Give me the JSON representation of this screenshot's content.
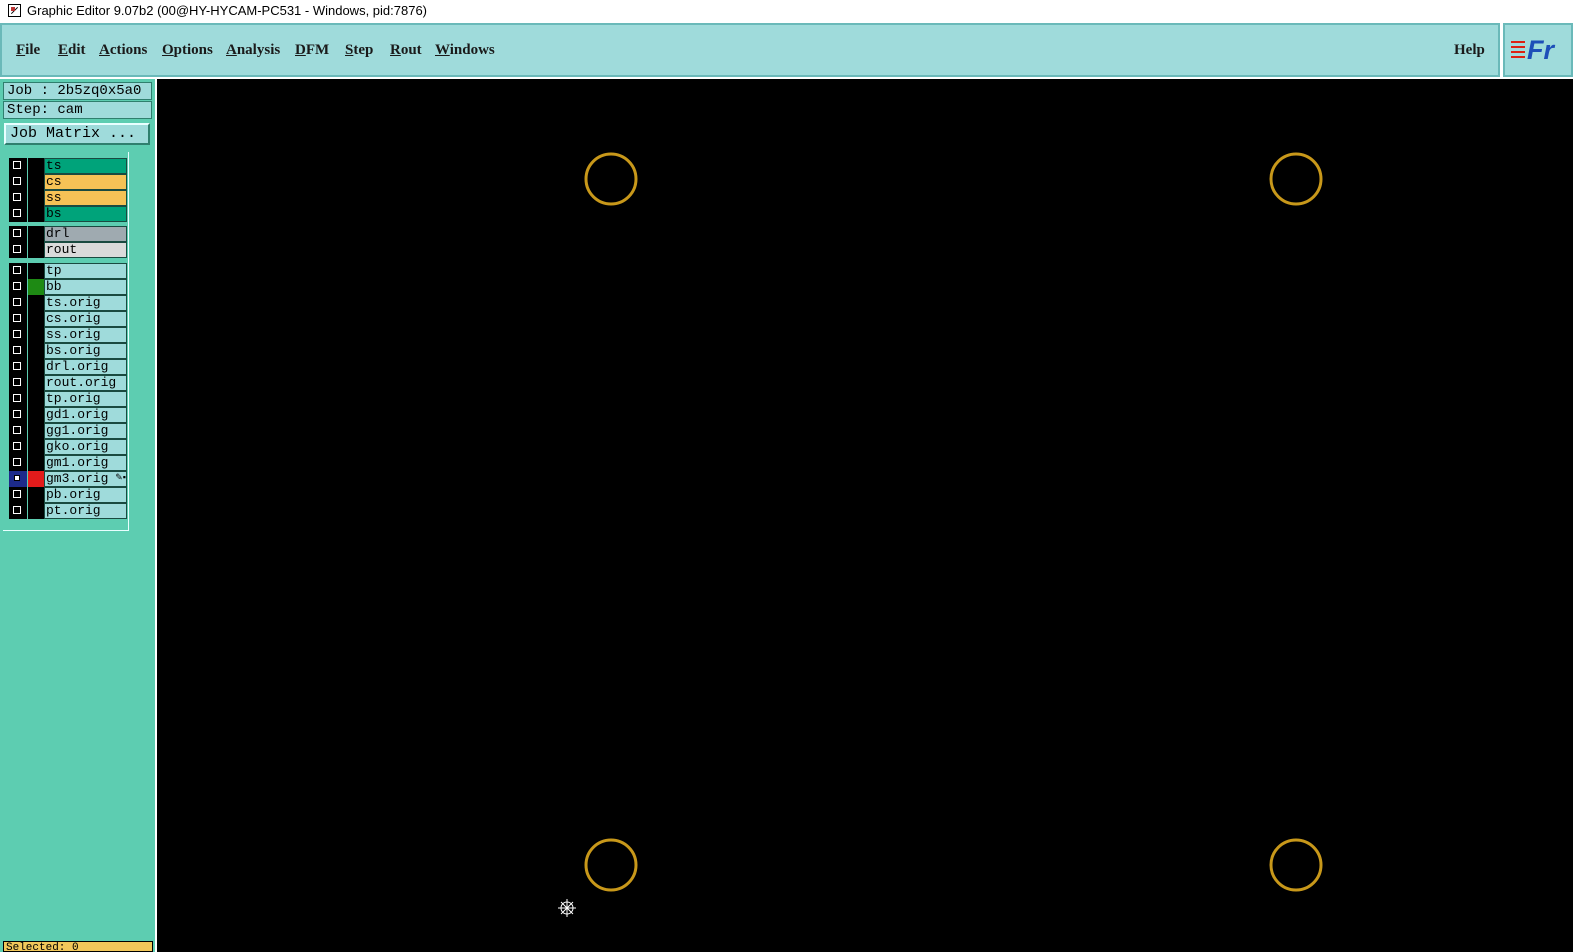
{
  "window": {
    "title": "Graphic Editor 9.07b2 (00@HY-HYCAM-PC531 - Windows, pid:7876)"
  },
  "menu": {
    "items": [
      {
        "label": "File",
        "name": "file"
      },
      {
        "label": "Edit",
        "name": "edit"
      },
      {
        "label": "Actions",
        "name": "actions"
      },
      {
        "label": "Options",
        "name": "options"
      },
      {
        "label": "Analysis",
        "name": "analysis"
      },
      {
        "label": "DFM",
        "name": "dfm"
      },
      {
        "label": "Step",
        "name": "step"
      },
      {
        "label": "Rout",
        "name": "rout"
      },
      {
        "label": "Windows",
        "name": "windows"
      }
    ],
    "help": "Help",
    "logo_text": "Fr"
  },
  "panel": {
    "job": "Job : 2b5zq0x5a0",
    "step": "Step: cam",
    "job_matrix": "Job Matrix ...",
    "bottom_text": "Selected: 0"
  },
  "layers": [
    {
      "name": "ts",
      "bg": "#00a37a",
      "swatch": "#000000"
    },
    {
      "name": "cs",
      "bg": "#f6c256",
      "swatch": "#000000"
    },
    {
      "name": "ss",
      "bg": "#f6c256",
      "swatch": "#000000"
    },
    {
      "name": "bs",
      "bg": "#00a37a",
      "swatch": "#000000"
    },
    {
      "name": "drl",
      "bg": "#9faab0",
      "swatch": "#000000"
    },
    {
      "name": "rout",
      "bg": "#dadada",
      "swatch": "#000000"
    },
    {
      "name": "tp",
      "bg": "#9fdbdb",
      "swatch": "#000000"
    },
    {
      "name": "bb",
      "bg": "#9fdbdb",
      "swatch": "#1e8a14"
    },
    {
      "name": "ts.orig",
      "bg": "#9fdbdb",
      "swatch": "#000000"
    },
    {
      "name": "cs.orig",
      "bg": "#9fdbdb",
      "swatch": "#000000"
    },
    {
      "name": "ss.orig",
      "bg": "#9fdbdb",
      "swatch": "#000000"
    },
    {
      "name": "bs.orig",
      "bg": "#9fdbdb",
      "swatch": "#000000"
    },
    {
      "name": "drl.orig",
      "bg": "#9fdbdb",
      "swatch": "#000000"
    },
    {
      "name": "rout.orig",
      "bg": "#9fdbdb",
      "swatch": "#000000"
    },
    {
      "name": "tp.orig",
      "bg": "#9fdbdb",
      "swatch": "#000000"
    },
    {
      "name": "gd1.orig",
      "bg": "#9fdbdb",
      "swatch": "#000000"
    },
    {
      "name": "gg1.orig",
      "bg": "#9fdbdb",
      "swatch": "#000000"
    },
    {
      "name": "gko.orig",
      "bg": "#9fdbdb",
      "swatch": "#000000"
    },
    {
      "name": "gm1.orig",
      "bg": "#9fdbdb",
      "swatch": "#000000"
    },
    {
      "name": "gm3.orig",
      "bg": "#9fdbdb",
      "swatch": "#e31b1b",
      "selected": true,
      "editing": true
    },
    {
      "name": "pb.orig",
      "bg": "#9fdbdb",
      "swatch": "#000000"
    },
    {
      "name": "pt.orig",
      "bg": "#9fdbdb",
      "swatch": "#000000"
    }
  ],
  "canvas": {
    "background": "#000000",
    "feature_color": "#c8981a"
  }
}
